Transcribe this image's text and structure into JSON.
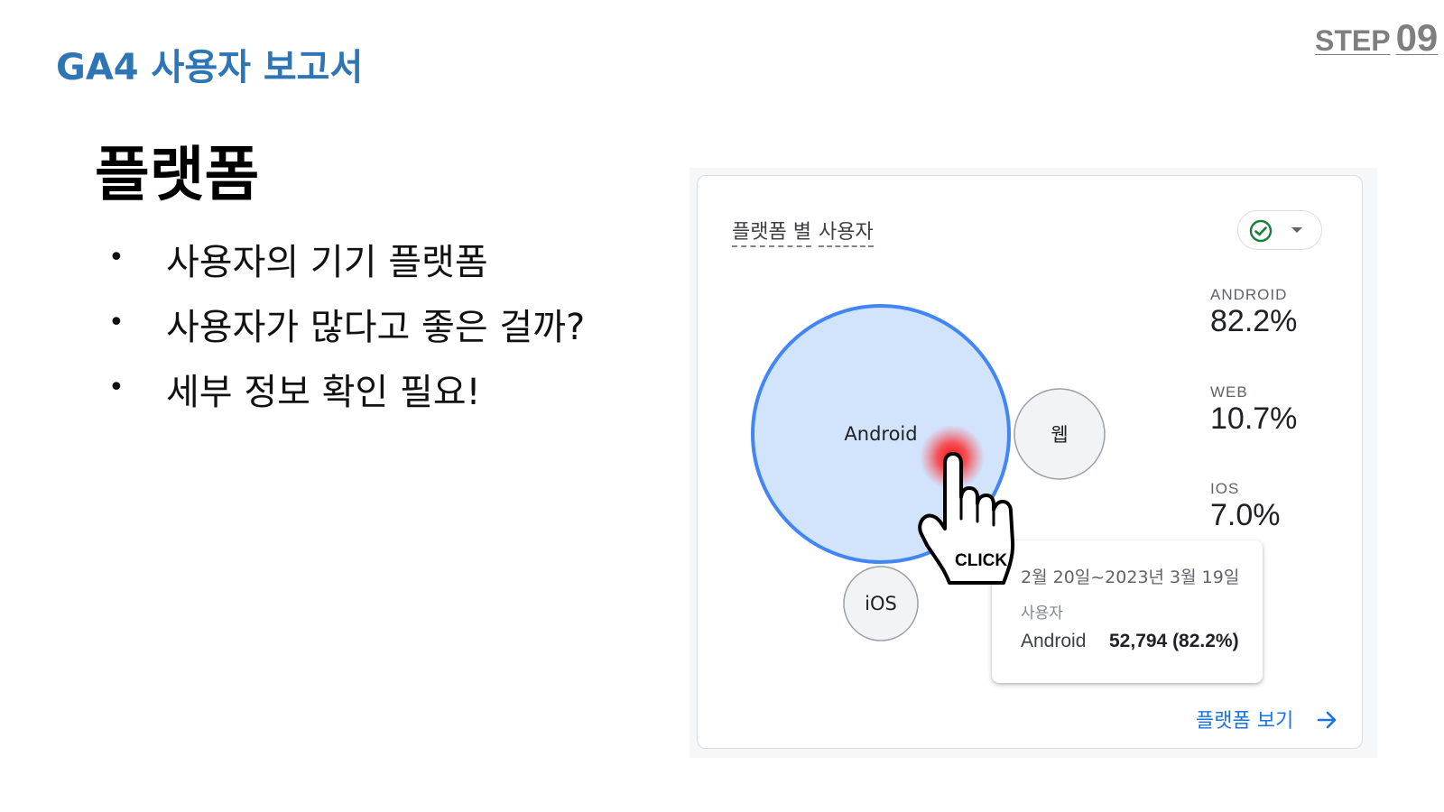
{
  "header": {
    "step_word": "STEP",
    "step_number": "09",
    "report_title": "GA4 사용자 보고서"
  },
  "page_title": "플랫폼",
  "bullets": [
    "사용자의 기기 플랫폼",
    "사용자가 많다고 좋은 걸까?",
    "세부 정보 확인 필요!"
  ],
  "card": {
    "title_part1": "플랫폼 별",
    "title_part2": "사용자",
    "status_icon": "check-circle-icon",
    "status_color": "#188038",
    "bubbles": [
      {
        "name": "Android",
        "share_percent": 82.2,
        "label": "Android",
        "highlighted": true,
        "fill": "#d2e3fc",
        "stroke": "#4285f4"
      },
      {
        "name": "웹",
        "share_percent": 10.7,
        "label": "웹",
        "highlighted": false,
        "fill": "#f1f3f4",
        "stroke": "#9aa0a6"
      },
      {
        "name": "iOS",
        "share_percent": 7.0,
        "label": "iOS",
        "highlighted": false,
        "fill": "#f1f3f4",
        "stroke": "#9aa0a6"
      }
    ],
    "stats": [
      {
        "name": "ANDROID",
        "value": "82.2%"
      },
      {
        "name": "WEB",
        "value": "10.7%"
      },
      {
        "name": "IOS",
        "value": "7.0%"
      }
    ],
    "tooltip": {
      "date_range": "2월 20일~2023년 3월 19일",
      "metric": "사용자",
      "row_label": "Android",
      "row_value": "52,794 (82.2%)"
    },
    "view_link": "플랫폼 보기",
    "link_color": "#1a73e8"
  },
  "pointer": {
    "icon": "hand-pointer-icon",
    "label": "CLICK",
    "glow_color": "#ff0000"
  },
  "colors": {
    "accent": "#2e75b6",
    "step_gray": "#7f7f7f"
  }
}
